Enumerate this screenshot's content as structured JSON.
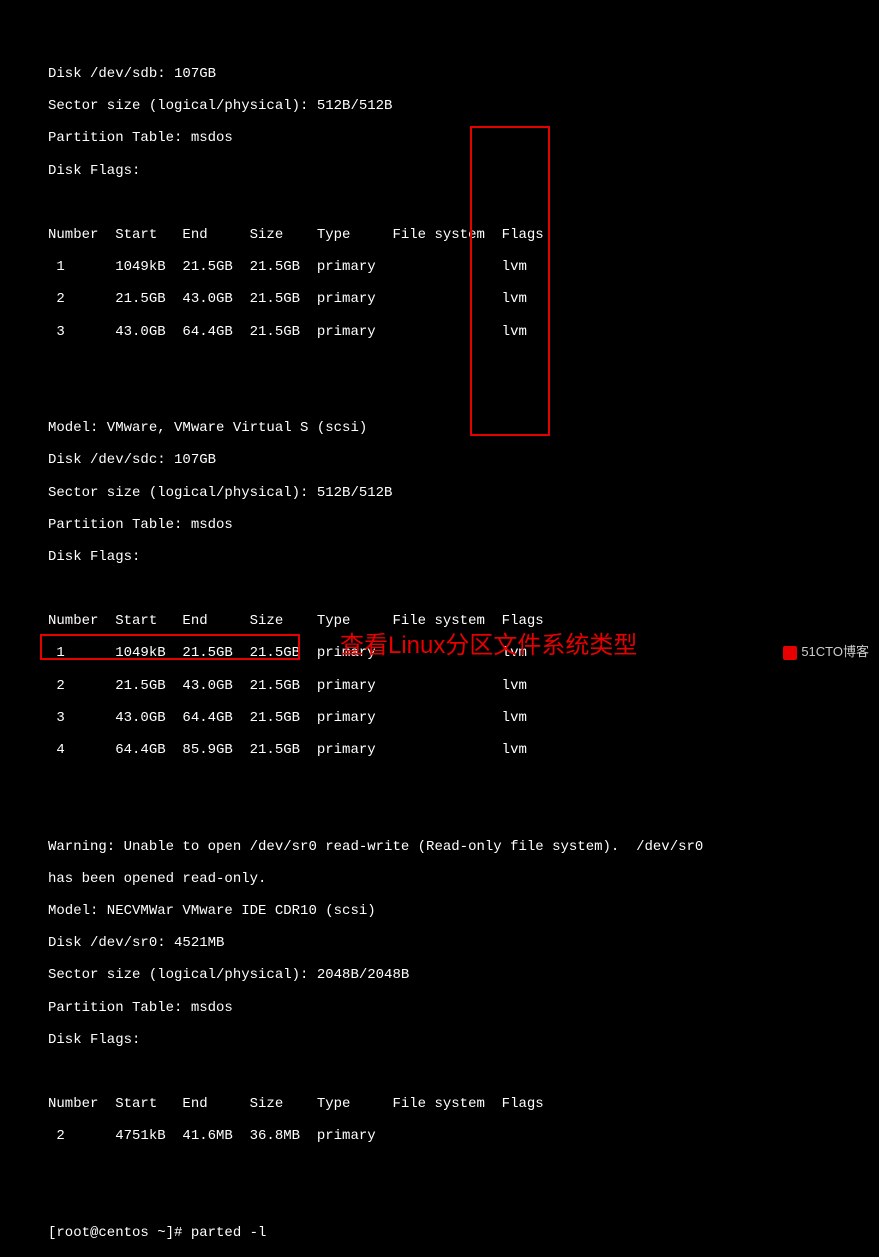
{
  "terminal": {
    "sdb": {
      "disk_line": "Disk /dev/sdb: 107GB",
      "sector_line": "Sector size (logical/physical): 512B/512B",
      "ptable_line": "Partition Table: msdos",
      "flags_line": "Disk Flags:",
      "header": "Number  Start   End     Size    Type     File system  Flags",
      "rows": [
        " 1      1049kB  21.5GB  21.5GB  primary               lvm",
        " 2      21.5GB  43.0GB  21.5GB  primary               lvm",
        " 3      43.0GB  64.4GB  21.5GB  primary               lvm"
      ]
    },
    "sdc": {
      "model_line": "Model: VMware, VMware Virtual S (scsi)",
      "disk_line": "Disk /dev/sdc: 107GB",
      "sector_line": "Sector size (logical/physical): 512B/512B",
      "ptable_line": "Partition Table: msdos",
      "flags_line": "Disk Flags:",
      "header": "Number  Start   End     Size    Type     File system  Flags",
      "rows": [
        " 1      1049kB  21.5GB  21.5GB  primary               lvm",
        " 2      21.5GB  43.0GB  21.5GB  primary               lvm",
        " 3      43.0GB  64.4GB  21.5GB  primary               lvm",
        " 4      64.4GB  85.9GB  21.5GB  primary               lvm"
      ]
    },
    "sr0": {
      "warning_l1": "Warning: Unable to open /dev/sr0 read-write (Read-only file system).  /dev/sr0",
      "warning_l2": "has been opened read-only.",
      "model_line": "Model: NECVMWar VMware IDE CDR10 (scsi)",
      "disk_line": "Disk /dev/sr0: 4521MB",
      "sector_line": "Sector size (logical/physical): 2048B/2048B",
      "ptable_line": "Partition Table: msdos",
      "flags_line": "Disk Flags:",
      "header": "Number  Start   End     Size    Type     File system  Flags",
      "rows": [
        " 2      4751kB  41.6MB  36.8MB  primary"
      ]
    },
    "prompt": "[root@centos ~]# parted -l"
  },
  "annotation": "查看Linux分区文件系统类型",
  "watermark": "51CTO博客"
}
